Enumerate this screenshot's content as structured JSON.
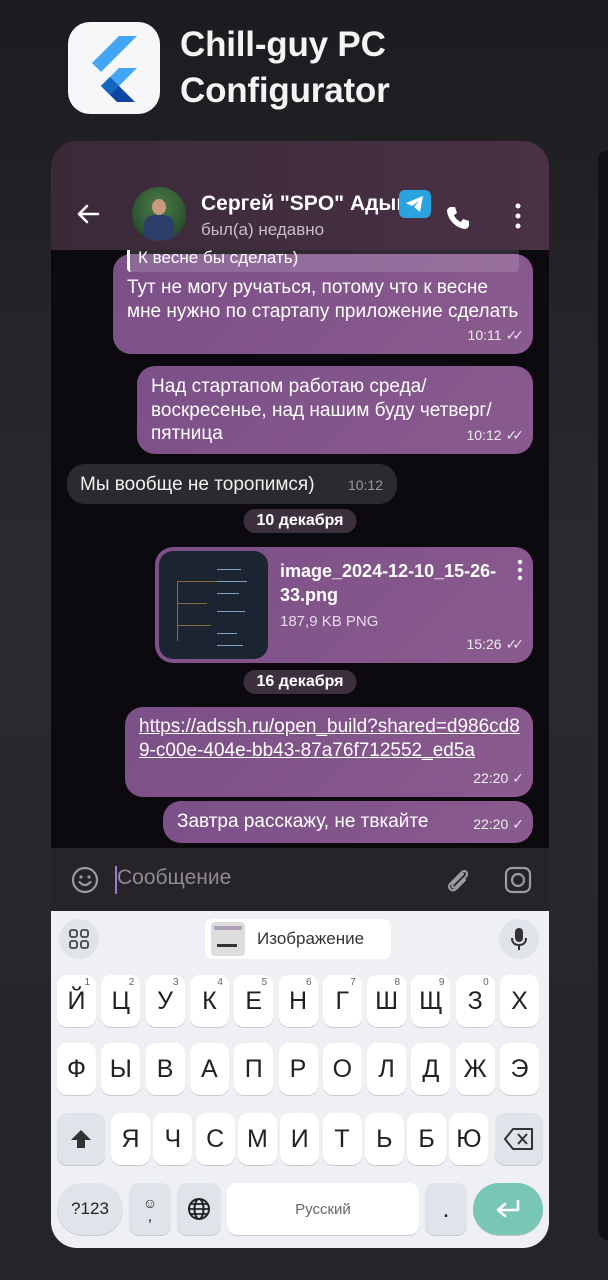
{
  "app": {
    "title": "Chill-guy PC Configurator",
    "icon": "flutter-icon"
  },
  "chat": {
    "contact_name": "Сергей \"SPO\" Адышкин",
    "status": "был(а) недавно",
    "icons": {
      "back": "arrow-left-icon",
      "telegram": "telegram-icon",
      "call": "phone-icon",
      "menu": "more-vert-icon"
    }
  },
  "messages": {
    "m1": {
      "quote": "К весне бы сделать)",
      "text": "Тут не могу ручаться, потому что к весне мне нужно по стартапу приложение сделать",
      "time": "10:11"
    },
    "m2": {
      "text": "Над стартапом работаю среда/ воскресенье, над нашим буду четверг/ пятница",
      "time": "10:12"
    },
    "m3": {
      "text": "Мы вообще не торопимся)",
      "time": "10:12"
    },
    "date1": "10 декабря",
    "file": {
      "name": "image_2024-12-10_15-26-33.png",
      "size": "187,9 KB PNG",
      "time": "15:26"
    },
    "date2": "16 декабря",
    "link": {
      "text": "https://adssh.ru/open_build?shared=d986cd89-c00e-404e-bb43-87a76f712552_ed5a",
      "time": "22:20"
    },
    "m4": {
      "text": "Завтра расскажу, не твкайте",
      "time": "22:20"
    }
  },
  "input": {
    "placeholder": "Сообщение"
  },
  "keyboard": {
    "suggestion": "Изображение",
    "row1": [
      "Й",
      "Ц",
      "У",
      "К",
      "Е",
      "Н",
      "Г",
      "Ш",
      "Щ",
      "З",
      "Х"
    ],
    "row1_hints": [
      "1",
      "2",
      "3",
      "4",
      "5",
      "6",
      "7",
      "8",
      "9",
      "0",
      ""
    ],
    "row2": [
      "Ф",
      "Ы",
      "В",
      "А",
      "П",
      "Р",
      "О",
      "Л",
      "Д",
      "Ж",
      "Э"
    ],
    "row3": [
      "Я",
      "Ч",
      "С",
      "М",
      "И",
      "Т",
      "Ь",
      "Б",
      "Ю"
    ],
    "symbols_key": "?123",
    "comma_key": ",",
    "space_label": "Русский",
    "period_key": "."
  },
  "colors": {
    "bubble_out": "#8a5b8e",
    "bubble_in": "#2b2a2e",
    "enter_key": "#78c6b5",
    "telegram": "#2aa3e0"
  }
}
